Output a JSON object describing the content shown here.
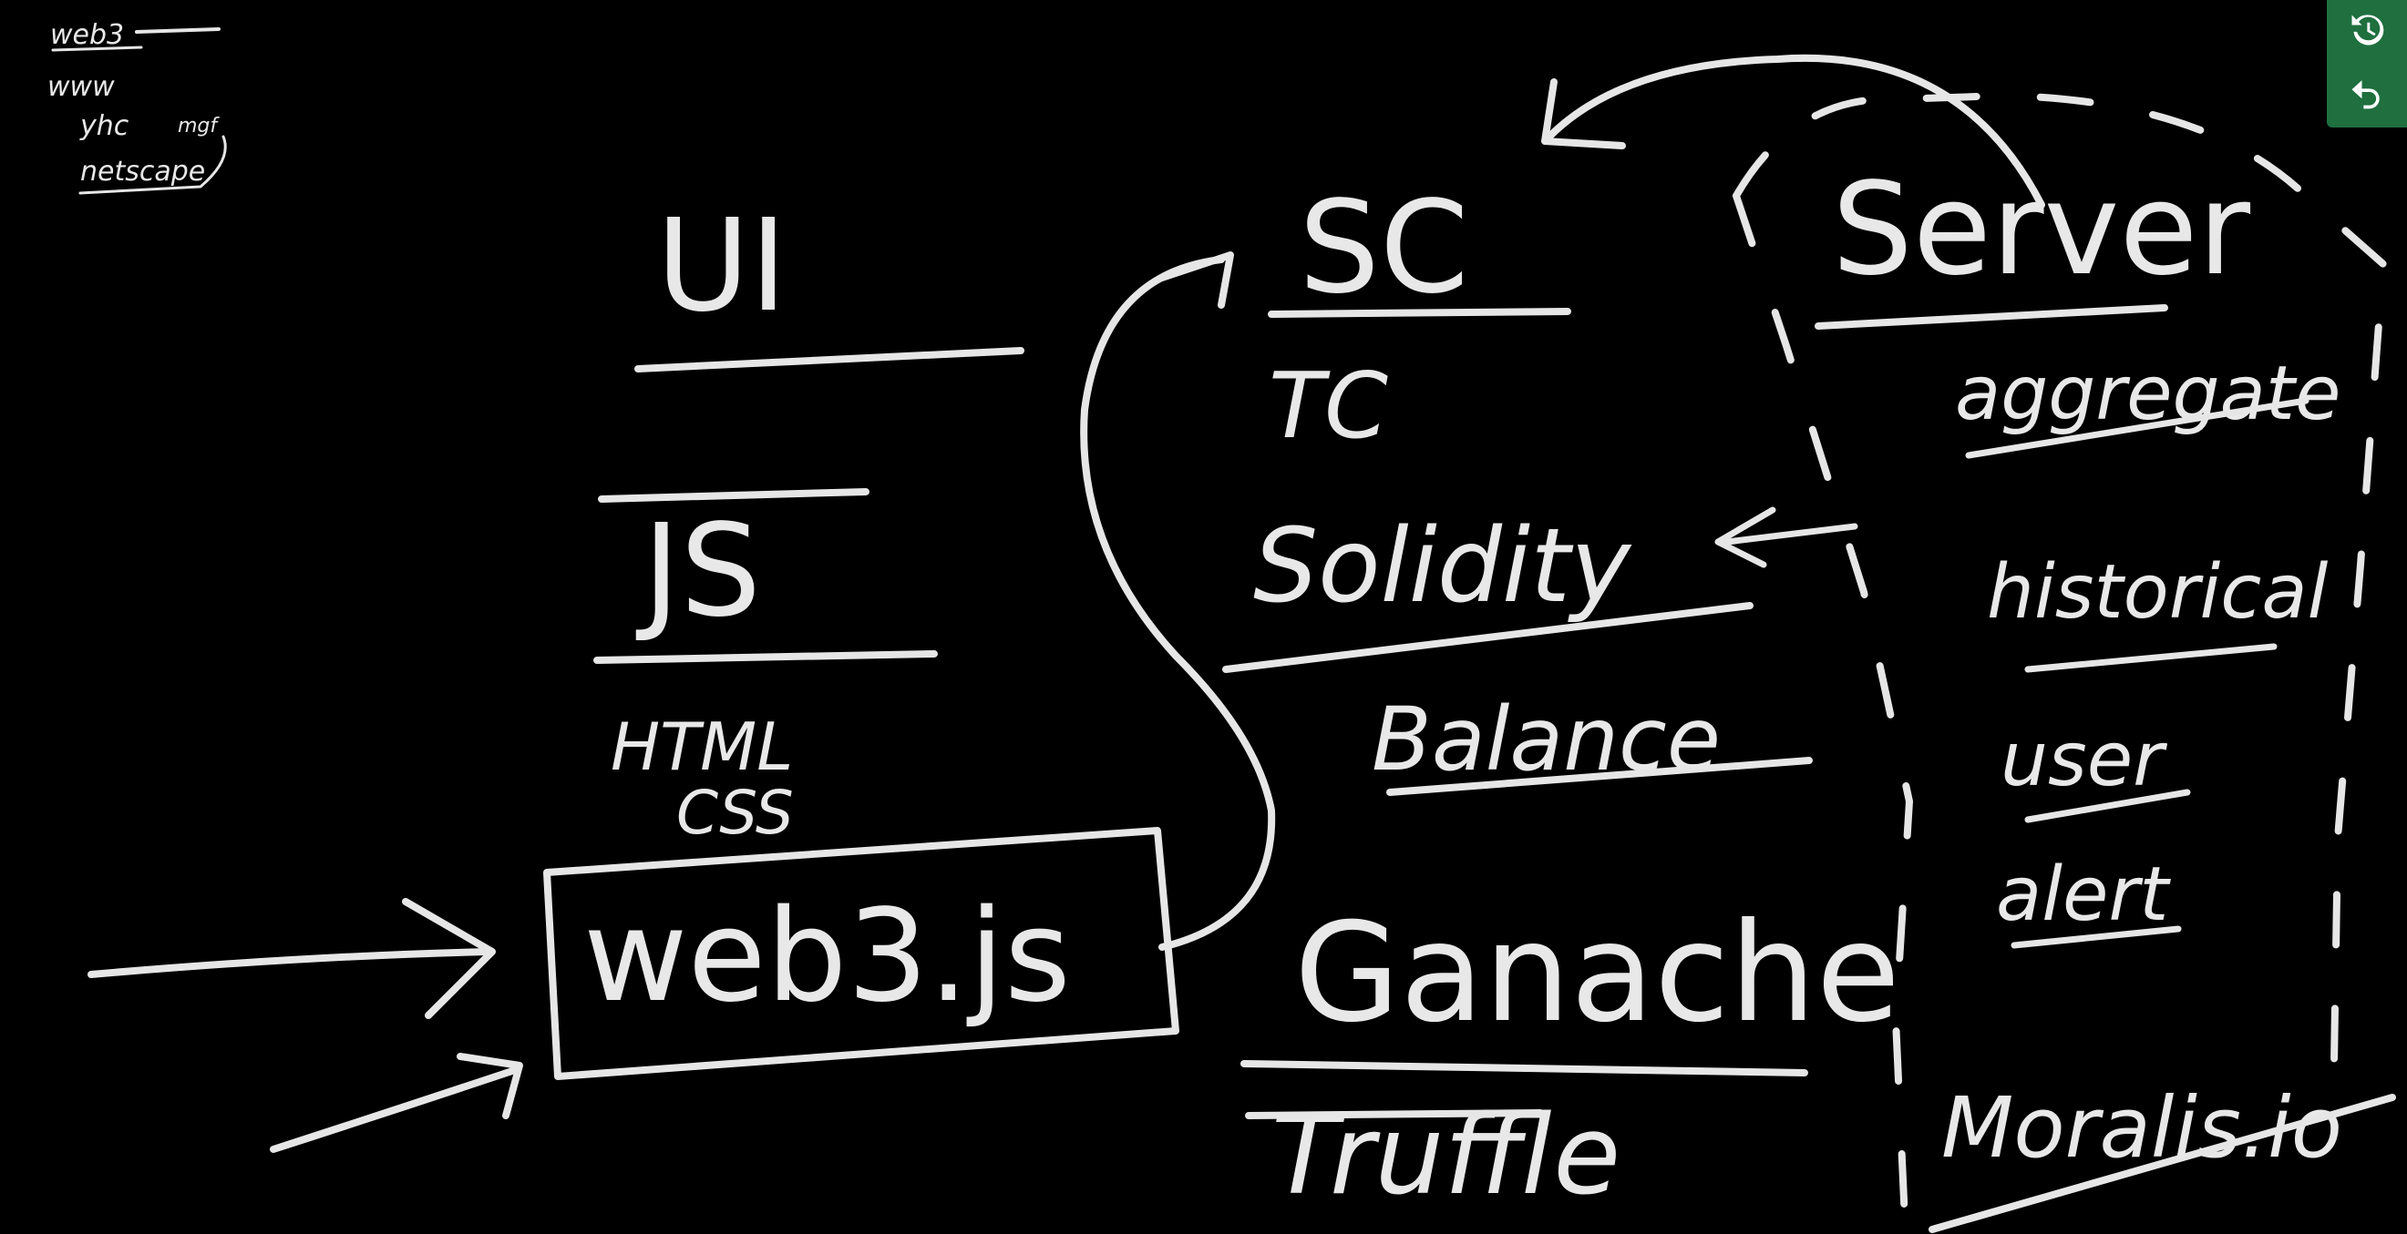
{
  "whiteboard": {
    "notes": {
      "line1": "web3",
      "line2": "www",
      "line3": "yhc",
      "line3b": "mgf",
      "line4": "netscape"
    },
    "left_column": {
      "ui": "UI",
      "js": "JS",
      "html": "HTML",
      "css": "CSS",
      "web3js": "web3.js"
    },
    "middle_column": {
      "sc": "SC",
      "tc": "TC",
      "solidity": "Solidity",
      "balance": "Balance",
      "ganache": "Ganache",
      "truffle": "Truffle"
    },
    "right_column": {
      "server": "Server",
      "aggregate": "aggregate",
      "historical": "historical",
      "user": "user",
      "alert": "alert",
      "moralis": "Moralis.io"
    }
  },
  "toolbar": {
    "history_icon": "history-icon",
    "undo_icon": "undo-icon",
    "background": "#1f6f3f"
  },
  "colors": {
    "board": "#000000",
    "ink": "#e6e6e6"
  }
}
